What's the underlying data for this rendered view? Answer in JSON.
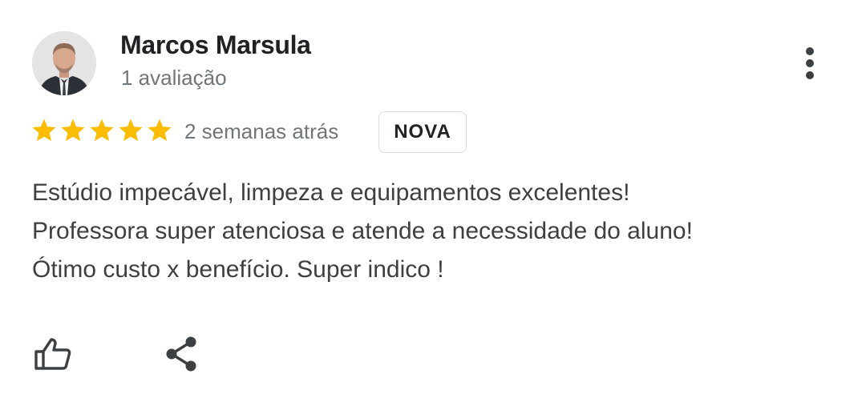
{
  "review": {
    "author": {
      "name": "Marcos Marsula",
      "meta": "1 avaliação",
      "avatar_icon": "user-photo"
    },
    "rating": 5,
    "rating_max": 5,
    "star_color": "#FBBC04",
    "time_ago": "2 semanas atrás",
    "badge": "NOVA",
    "text_lines": [
      "Estúdio impecável, limpeza e equipamentos excelentes!",
      "Professora super atenciosa e atende a necessidade do aluno!",
      "Ótimo custo x benefício. Super indico !"
    ],
    "actions": {
      "like_icon": "thumbs-up-icon",
      "share_icon": "share-icon",
      "more_icon": "more-vert-icon"
    }
  }
}
